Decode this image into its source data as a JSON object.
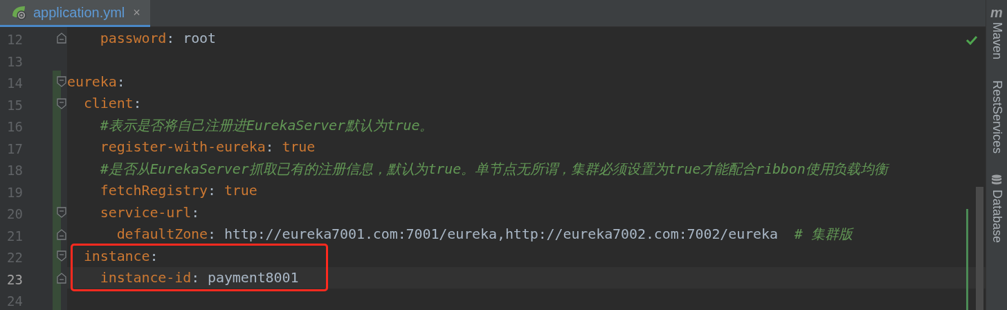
{
  "tabs": [
    {
      "label": "application.yml",
      "selected": true,
      "close": "×"
    }
  ],
  "lines": [
    {
      "kind": "line",
      "number": "12",
      "current": false,
      "changed": false,
      "fold_start": false,
      "fold_end": true,
      "tokens": [
        {
          "kind": "key",
          "text": "    password"
        },
        {
          "kind": "punct",
          "text": ": "
        },
        {
          "kind": "value",
          "text": "root"
        }
      ]
    },
    {
      "kind": "line",
      "number": "13",
      "current": false,
      "changed": false,
      "fold_start": false,
      "fold_end": false
    },
    {
      "kind": "line",
      "number": "14",
      "current": false,
      "changed": true,
      "fold_start": true,
      "fold_end": false,
      "tokens": [
        {
          "kind": "key",
          "text": "eureka"
        },
        {
          "kind": "punct",
          "text": ":"
        }
      ]
    },
    {
      "kind": "line",
      "number": "15",
      "current": false,
      "changed": true,
      "fold_start": true,
      "fold_end": false,
      "tokens": [
        {
          "kind": "key",
          "text": "  client"
        },
        {
          "kind": "punct",
          "text": ":"
        }
      ]
    },
    {
      "kind": "line",
      "number": "16",
      "current": false,
      "changed": true,
      "fold_start": false,
      "fold_end": false,
      "tokens": [
        {
          "kind": "comment",
          "text": "    #表示是否将自己注册进EurekaServer默认为true。"
        }
      ]
    },
    {
      "kind": "line",
      "number": "17",
      "current": false,
      "changed": true,
      "fold_start": false,
      "fold_end": false,
      "tokens": [
        {
          "kind": "key",
          "text": "    register-with-eureka"
        },
        {
          "kind": "punct",
          "text": ": "
        },
        {
          "kind": "keyword",
          "text": "true"
        }
      ]
    },
    {
      "kind": "line",
      "number": "18",
      "current": false,
      "changed": true,
      "fold_start": false,
      "fold_end": false,
      "tokens": [
        {
          "kind": "comment",
          "text": "    #是否从EurekaServer抓取已有的注册信息，默认为true。单节点无所谓，集群必须设置为true才能配合ribbon使用负载均衡"
        }
      ]
    },
    {
      "kind": "line",
      "number": "19",
      "current": false,
      "changed": true,
      "fold_start": false,
      "fold_end": false,
      "tokens": [
        {
          "kind": "key",
          "text": "    fetchRegistry"
        },
        {
          "kind": "punct",
          "text": ": "
        },
        {
          "kind": "keyword",
          "text": "true"
        }
      ]
    },
    {
      "kind": "line",
      "number": "20",
      "current": false,
      "changed": true,
      "fold_start": true,
      "fold_end": false,
      "tokens": [
        {
          "kind": "key",
          "text": "    service-url"
        },
        {
          "kind": "punct",
          "text": ":"
        }
      ]
    },
    {
      "kind": "line",
      "number": "21",
      "current": false,
      "changed": true,
      "fold_start": false,
      "fold_end": true,
      "tokens": [
        {
          "kind": "key",
          "text": "      defaultZone"
        },
        {
          "kind": "punct",
          "text": ": "
        },
        {
          "kind": "value",
          "text": "http://eureka7001.com:7001/eureka,http://eureka7002.com:7002/eureka"
        },
        {
          "kind": "comment",
          "text": "  # 集群版"
        }
      ]
    },
    {
      "kind": "highlight",
      "color": "#ff2a1f",
      "lines": [
        {
          "kind": "line",
          "number": "22",
          "current": false,
          "changed": true,
          "fold_start": true,
          "fold_end": false,
          "tokens": [
            {
              "kind": "key",
              "text": "  instance"
            },
            {
              "kind": "punct",
              "text": ":"
            }
          ]
        },
        {
          "kind": "line",
          "number": "23",
          "current": true,
          "changed": true,
          "fold_start": false,
          "fold_end": true,
          "tokens": [
            {
              "kind": "key",
              "text": "    instance-id"
            },
            {
              "kind": "punct",
              "text": ": "
            },
            {
              "kind": "value",
              "text": "payment8001"
            }
          ]
        }
      ]
    },
    {
      "kind": "line",
      "number": "24",
      "current": false,
      "changed": true,
      "fold_start": false,
      "fold_end": false
    }
  ],
  "inspection": {
    "ok": true
  },
  "side_tools": [
    {
      "kind": "maven",
      "icon_text": "m",
      "label": "Maven"
    },
    {
      "kind": "plain",
      "label": "RestServices"
    },
    {
      "kind": "database",
      "label": "Database"
    }
  ]
}
